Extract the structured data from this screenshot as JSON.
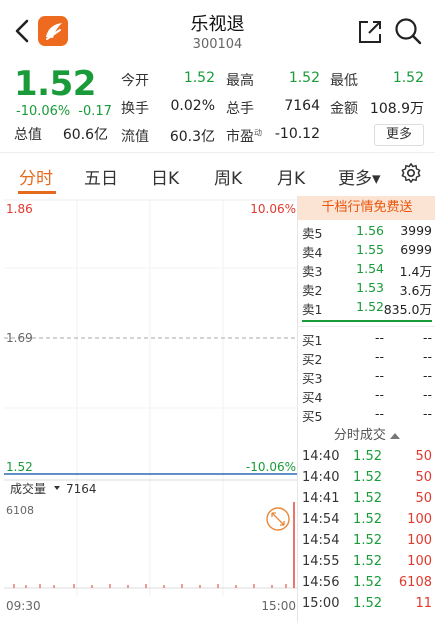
{
  "header": {
    "title": "乐视退",
    "code": "300104"
  },
  "quote": {
    "price": "1.52",
    "change_pct": "-10.06%",
    "change_abs": "-0.17",
    "total_cap_label": "总值",
    "total_cap": "60.6亿",
    "metrics": [
      {
        "label": "今开",
        "value": "1.52"
      },
      {
        "label": "最高",
        "value": "1.52"
      },
      {
        "label": "最低",
        "value": "1.52"
      },
      {
        "label": "换手",
        "value": "0.02%"
      },
      {
        "label": "总手",
        "value": "7164"
      },
      {
        "label": "金额",
        "value": "108.9万"
      },
      {
        "label": "流值",
        "value": "60.3亿"
      },
      {
        "label": "市盈",
        "value": "-10.12",
        "sup": "动"
      }
    ],
    "more_label": "更多"
  },
  "tabs": [
    {
      "label": "分时"
    },
    {
      "label": "五日"
    },
    {
      "label": "日K"
    },
    {
      "label": "周K"
    },
    {
      "label": "月K"
    },
    {
      "label": "更多▾"
    }
  ],
  "chart": {
    "price_top": "1.86",
    "pct_top": "10.06%",
    "price_mid": "1.69",
    "price_bottom": "1.52",
    "pct_bottom": "-10.06%",
    "volume_label": "成交量",
    "volume_value": "7164",
    "volume_max": "6108",
    "time_start": "09:30",
    "time_end": "15:00"
  },
  "sidepanel": {
    "promo": "千档行情免费送",
    "asks": [
      {
        "label": "卖5",
        "price": "1.56",
        "volume": "3999"
      },
      {
        "label": "卖4",
        "price": "1.55",
        "volume": "6999"
      },
      {
        "label": "卖3",
        "price": "1.54",
        "volume": "1.4万"
      },
      {
        "label": "卖2",
        "price": "1.53",
        "volume": "3.6万"
      },
      {
        "label": "卖1",
        "price": "1.52",
        "volume": "835.0万"
      }
    ],
    "bids": [
      {
        "label": "买1",
        "price": "--",
        "volume": "--"
      },
      {
        "label": "买2",
        "price": "--",
        "volume": "--"
      },
      {
        "label": "买3",
        "price": "--",
        "volume": "--"
      },
      {
        "label": "买4",
        "price": "--",
        "volume": "--"
      },
      {
        "label": "买5",
        "price": "--",
        "volume": "--"
      }
    ],
    "ticks_header": "分时成交",
    "ticks": [
      {
        "time": "14:40",
        "price": "1.52",
        "volume": "50"
      },
      {
        "time": "14:40",
        "price": "1.52",
        "volume": "50"
      },
      {
        "time": "14:41",
        "price": "1.52",
        "volume": "50"
      },
      {
        "time": "14:54",
        "price": "1.52",
        "volume": "100"
      },
      {
        "time": "14:54",
        "price": "1.52",
        "volume": "100"
      },
      {
        "time": "14:55",
        "price": "1.52",
        "volume": "100"
      },
      {
        "time": "14:56",
        "price": "1.52",
        "volume": "6108"
      },
      {
        "time": "15:00",
        "price": "1.52",
        "volume": "11"
      }
    ]
  },
  "colors": {
    "up": "#e03a2e",
    "down": "#1a9b3a",
    "accent": "#e46a1e"
  },
  "icons": [
    "back-icon",
    "app-logo-icon",
    "share-icon",
    "search-icon",
    "gear-icon",
    "chevron-down-icon",
    "chevron-up-icon",
    "expand-icon"
  ]
}
